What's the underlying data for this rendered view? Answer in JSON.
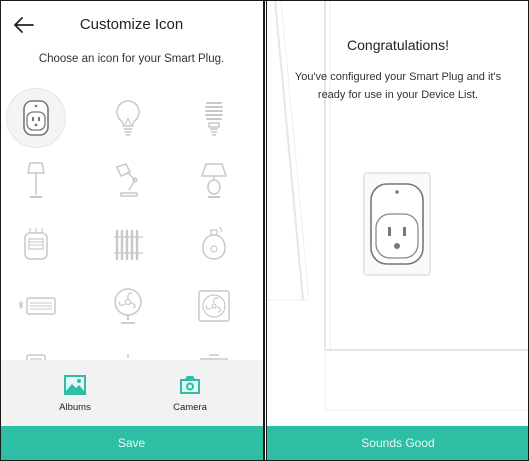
{
  "customize": {
    "title": "Customize Icon",
    "subtitle": "Choose an icon for your Smart Plug.",
    "icons": [
      "smart-plug",
      "light-bulb",
      "cfl-bulb",
      "floor-lamp",
      "desk-lamp",
      "table-lamp",
      "space-heater",
      "radiator",
      "humidifier",
      "air-conditioner",
      "desk-fan",
      "box-fan"
    ],
    "selected_icon": "smart-plug",
    "albums_label": "Albums",
    "camera_label": "Camera",
    "save_label": "Save"
  },
  "confirm": {
    "title": "Congratulations!",
    "message": "You've configured your Smart Plug and it's ready for use in your Device List.",
    "button_label": "Sounds Good"
  },
  "colors": {
    "accent": "#2dbea4",
    "icon_gray": "#c8c8c8",
    "bar_bg": "#f2f2f2"
  }
}
